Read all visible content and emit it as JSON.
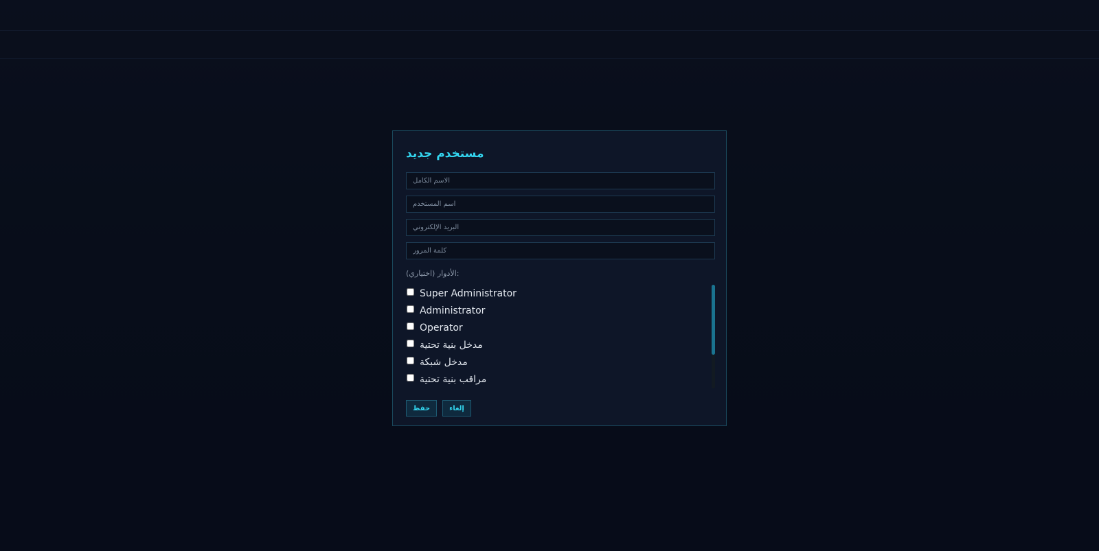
{
  "modal": {
    "title": "مستخدم جديد",
    "fields": {
      "full_name_placeholder": "الاسم الكامل",
      "username_placeholder": "اسم المستخدم",
      "email_placeholder": "البريد الإلكتروني",
      "password_placeholder": "كلمة المرور"
    },
    "roles_label": "الأدوار (اختياري):",
    "roles": [
      {
        "label": "Super Administrator",
        "checked": false
      },
      {
        "label": "Administrator",
        "checked": false
      },
      {
        "label": "Operator",
        "checked": false
      },
      {
        "label": "مدخل بنية تحتية",
        "checked": false
      },
      {
        "label": "مدخل شبكة",
        "checked": false
      },
      {
        "label": "مراقب بنية تحتية",
        "checked": false
      }
    ],
    "buttons": {
      "save_label": "حفظ",
      "cancel_label": "إلغاء"
    }
  },
  "colors": {
    "accent": "#33d6f0",
    "background": "#0c1322",
    "modal_background": "#0e1628",
    "modal_border": "#1a4a5e"
  }
}
